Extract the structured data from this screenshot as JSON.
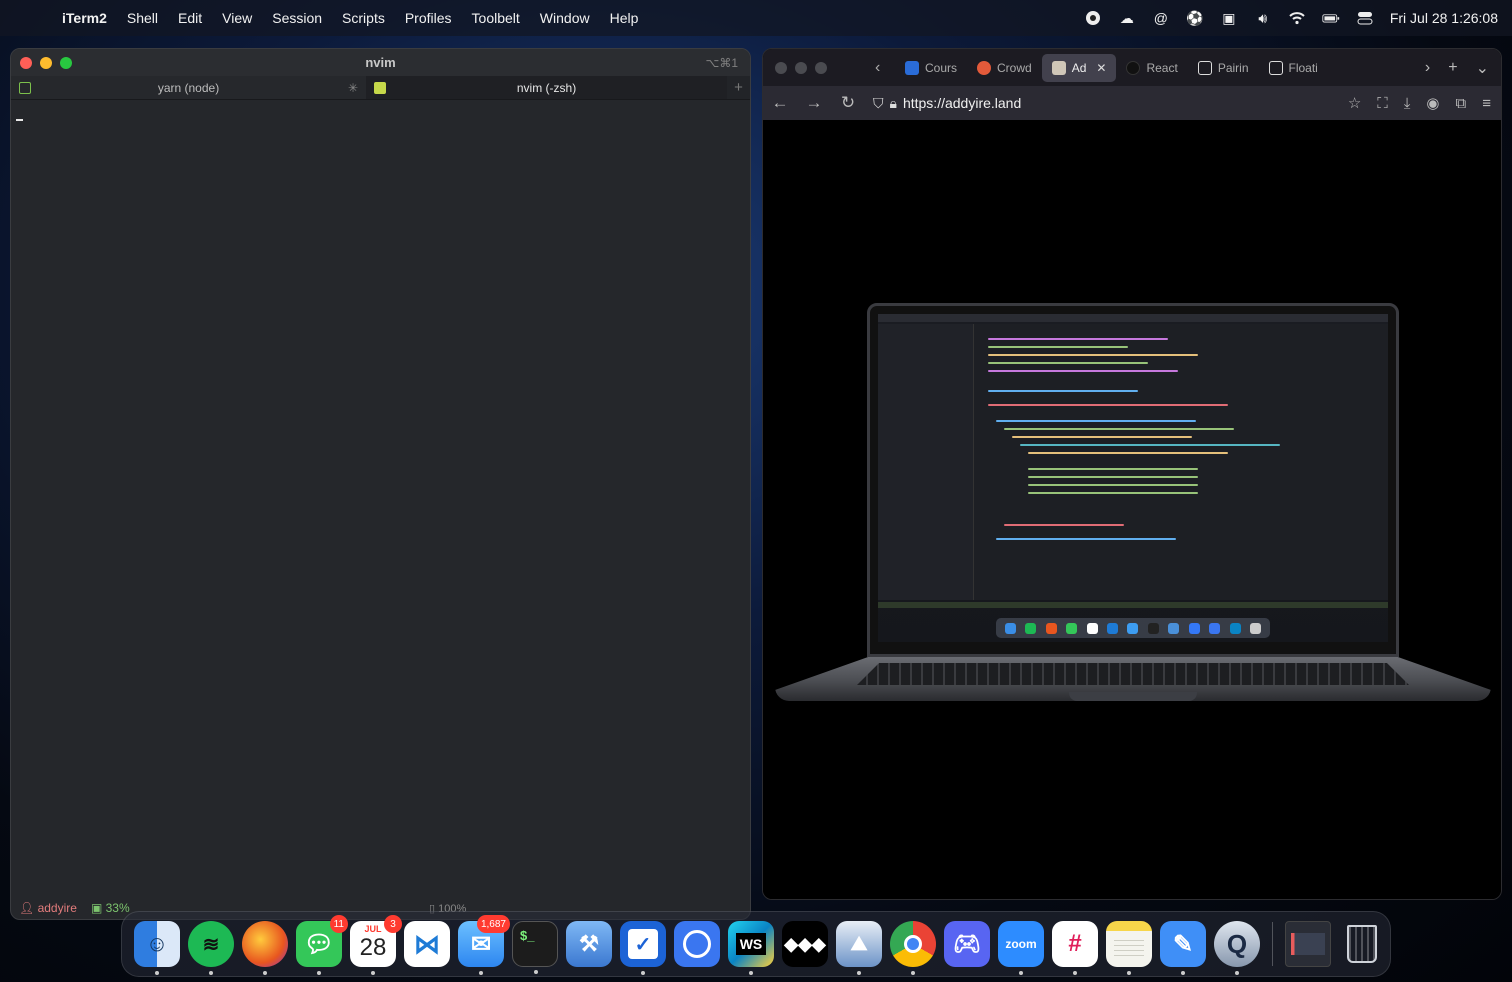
{
  "menubar": {
    "app_name": "iTerm2",
    "items": [
      "Shell",
      "Edit",
      "View",
      "Session",
      "Scripts",
      "Profiles",
      "Toolbelt",
      "Window",
      "Help"
    ],
    "clock": "Fri Jul 28  1:26:08"
  },
  "iterm": {
    "title": "nvim",
    "shortcut": "⌥⌘1",
    "tabs": [
      {
        "label": "yarn (node)"
      },
      {
        "label": "nvim (-zsh)"
      }
    ],
    "new_tab": "+",
    "status": {
      "user": "addyire",
      "cpu": "33%",
      "battery": "100%"
    }
  },
  "browser": {
    "tabs": [
      {
        "label": "Cours",
        "favicon_color": "#2a6cd8"
      },
      {
        "label": "Crowd",
        "favicon_color": "#e35a3a"
      },
      {
        "label": "Ad",
        "favicon_color": "#d0c7b8"
      },
      {
        "label": "React",
        "favicon_color": "#111111"
      },
      {
        "label": "Pairin",
        "favicon_color": "#ffffff"
      },
      {
        "label": "Floati",
        "favicon_color": "#ffffff"
      }
    ],
    "url": "https://addyire.land"
  },
  "dock": {
    "apps": [
      {
        "name": "Finder",
        "color": "#3a8ee6",
        "dot": true
      },
      {
        "name": "Spotify",
        "color": "#1db954",
        "dot": true
      },
      {
        "name": "Firefox",
        "color": "#e8561f",
        "dot": true
      },
      {
        "name": "Messages",
        "color": "#34c759",
        "dot": true,
        "badge": "11"
      },
      {
        "name": "Calendar",
        "color": "#ffffff",
        "dot": true,
        "badge": "3",
        "month": "JUL",
        "day": "28"
      },
      {
        "name": "Visual Studio Code",
        "color": "#1e7bd6",
        "dot": false
      },
      {
        "name": "Mail",
        "color": "#3d9df2",
        "dot": true,
        "badge": "1,687"
      },
      {
        "name": "Terminal",
        "color": "#1c1c1c",
        "dot": true
      },
      {
        "name": "Xcode",
        "color": "#4a90d9",
        "dot": false
      },
      {
        "name": "Reminders",
        "color": "#3478f6",
        "dot": true
      },
      {
        "name": "Signal",
        "color": "#3a76f0",
        "dot": false
      },
      {
        "name": "WebStorm",
        "color": "#0a84c4",
        "dot": true,
        "label": "WS"
      },
      {
        "name": "Tidal",
        "color": "#000000",
        "dot": false
      },
      {
        "name": "Preview",
        "color": "#dfe6ee",
        "dot": true
      },
      {
        "name": "Chrome",
        "color": "#ffffff",
        "dot": true
      },
      {
        "name": "Discord",
        "color": "#5865f2",
        "dot": false
      },
      {
        "name": "Zoom",
        "color": "#2d8cff",
        "dot": true,
        "label": "zoom"
      },
      {
        "name": "Slack",
        "color": "#ffffff",
        "dot": true
      },
      {
        "name": "Notes",
        "color": "#f2f2ea",
        "dot": true
      },
      {
        "name": "Pages",
        "color": "#3f8ff7",
        "dot": true
      },
      {
        "name": "QuickTime",
        "color": "#c9d3e0",
        "dot": true
      }
    ]
  }
}
